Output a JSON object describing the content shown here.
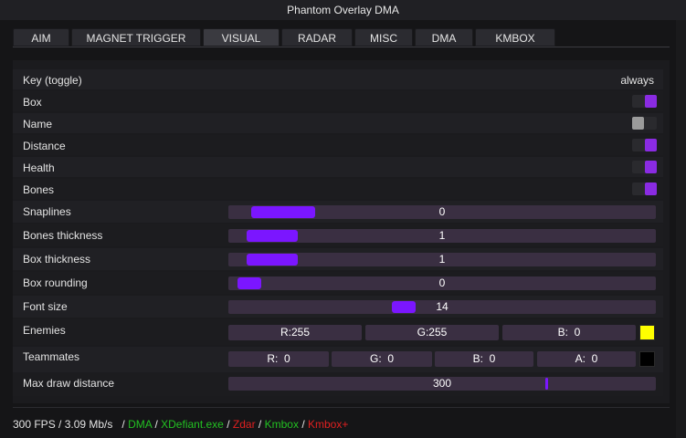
{
  "window": {
    "title": "Phantom Overlay DMA"
  },
  "tabs": [
    {
      "label": "AIM"
    },
    {
      "label": "MAGNET TRIGGER"
    },
    {
      "label": "VISUAL"
    },
    {
      "label": "RADAR"
    },
    {
      "label": "MISC"
    },
    {
      "label": "DMA"
    },
    {
      "label": "KMBOX"
    }
  ],
  "active_tab": "VISUAL",
  "visual": {
    "key_toggle": {
      "label": "Key (toggle)",
      "value": "always"
    },
    "box": {
      "label": "Box",
      "enabled": true
    },
    "name": {
      "label": "Name",
      "enabled": false
    },
    "distance": {
      "label": "Distance",
      "enabled": true
    },
    "health": {
      "label": "Health",
      "enabled": true
    },
    "bones": {
      "label": "Bones",
      "enabled": true
    },
    "snaplines": {
      "label": "Snaplines",
      "value": "0"
    },
    "bones_thickness": {
      "label": "Bones thickness",
      "value": "1"
    },
    "box_thickness": {
      "label": "Box thickness",
      "value": "1"
    },
    "box_rounding": {
      "label": "Box rounding",
      "value": "0"
    },
    "font_size": {
      "label": "Font size",
      "value": "14"
    },
    "enemies": {
      "label": "Enemies",
      "r": "R:255",
      "g": "G:255",
      "b": "B:  0",
      "color": "#ffff00"
    },
    "teammates": {
      "label": "Teammates",
      "r": "R:  0",
      "g": "G:  0",
      "b": "B:  0",
      "a": "A:  0",
      "color": "#000000"
    },
    "max_draw_distance": {
      "label": "Max draw distance",
      "value": "300"
    }
  },
  "status": {
    "fps": "300 FPS / 3.09 Mb/s",
    "sep": "/",
    "items": [
      {
        "text": "DMA",
        "color": "#22c022"
      },
      {
        "text": "XDefiant.exe",
        "color": "#22c022"
      },
      {
        "text": "Zdar",
        "color": "#e02020"
      },
      {
        "text": "Kmbox",
        "color": "#22c022"
      },
      {
        "text": "Kmbox+",
        "color": "#e02020"
      }
    ]
  },
  "colors": {
    "accent": "#7b16ff",
    "toggle_on": "#8a2be2"
  }
}
